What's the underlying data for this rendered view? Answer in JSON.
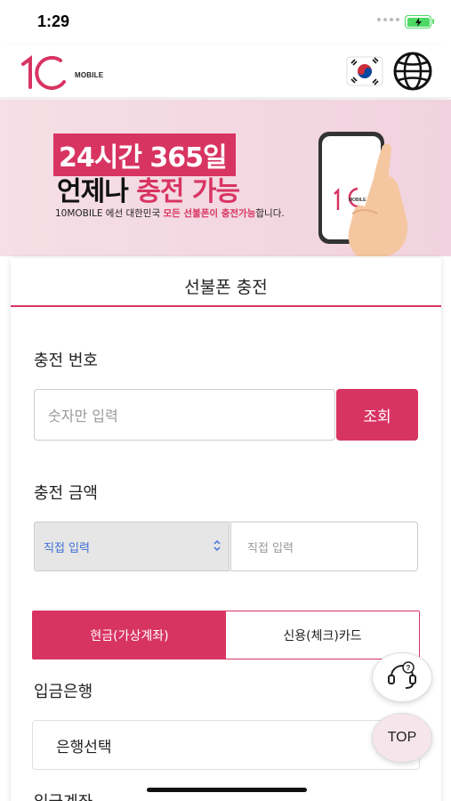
{
  "status_bar": {
    "time": "1:29"
  },
  "header": {
    "logo_main": "10",
    "logo_text": "MOBILE"
  },
  "banner": {
    "line1": "24시간 365일",
    "line2_prefix": "언제나 ",
    "line2_highlight": "충전 가능",
    "line3_a": "10MOBILE 에선 대한민국 ",
    "line3_highlight": "모든 선불폰이 충전가능",
    "line3_b": "합니다.",
    "phone_logo_main": "10",
    "phone_logo_text": "MOBILE"
  },
  "card": {
    "title": "선불폰 충전",
    "number_label": "충전 번호",
    "number_placeholder": "숫자만 입력",
    "lookup_button": "조회",
    "amount_label": "충전 금액",
    "amount_select_value": "직접 입력",
    "amount_input_placeholder": "직접 입력",
    "pay_tabs": [
      {
        "label": "현금(가상계좌)",
        "active": true
      },
      {
        "label": "신용(체크)카드",
        "active": false
      }
    ],
    "bank_label": "입금은행",
    "bank_select_value": "은행선택",
    "next_label": "입금계좌"
  },
  "floating": {
    "top_button": "TOP"
  },
  "colors": {
    "accent": "#d83462",
    "select_text": "#3d6fd6"
  }
}
